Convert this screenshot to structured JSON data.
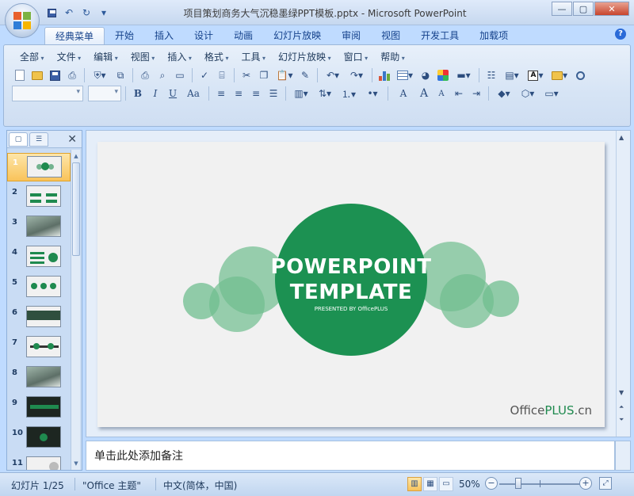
{
  "window": {
    "title": "项目策划商务大气沉稳墨绿PPT模板.pptx - Microsoft PowerPoint",
    "minimize": "—",
    "maximize": "▢",
    "close": "✕"
  },
  "qat": {
    "save_icon": "save-icon",
    "undo_icon": "undo-icon",
    "redo_icon": "redo-icon",
    "customize": "▾"
  },
  "tabs": [
    {
      "label": "经典菜单",
      "active": true
    },
    {
      "label": "开始"
    },
    {
      "label": "插入"
    },
    {
      "label": "设计"
    },
    {
      "label": "动画"
    },
    {
      "label": "幻灯片放映"
    },
    {
      "label": "审阅"
    },
    {
      "label": "视图"
    },
    {
      "label": "开发工具"
    },
    {
      "label": "加载项"
    }
  ],
  "help": "?",
  "menus": [
    "全部",
    "文件",
    "编辑",
    "视图",
    "插入",
    "格式",
    "工具",
    "幻灯片放映",
    "窗口",
    "帮助"
  ],
  "format": {
    "bold": "B",
    "italic": "I",
    "underline": "U",
    "case": "Aa",
    "grow_font": "A",
    "shrink_font": "A",
    "text_box": "A"
  },
  "left_panel": {
    "tab_slides_icon": "slides-tab-icon",
    "tab_outline_icon": "outline-tab-icon",
    "close": "✕",
    "slides": [
      {
        "num": "1",
        "selected": true
      },
      {
        "num": "2"
      },
      {
        "num": "3"
      },
      {
        "num": "4"
      },
      {
        "num": "5"
      },
      {
        "num": "6"
      },
      {
        "num": "7"
      },
      {
        "num": "8"
      },
      {
        "num": "9"
      },
      {
        "num": "10"
      },
      {
        "num": "11"
      }
    ]
  },
  "slide": {
    "title_line1": "POWERPOINT",
    "title_line2": "TEMPLATE",
    "subtitle": "PRESENTED BY OfficePLUS",
    "brand_office": "Office",
    "brand_plus": "PLUS",
    "brand_cn": ".cn",
    "accent": "#1c9152",
    "accent_light": "#6fbd8f"
  },
  "notes": {
    "placeholder": "单击此处添加备注"
  },
  "status": {
    "slide_info": "幻灯片 1/25",
    "theme": "\"Office 主题\"",
    "language": "中文(简体，中国)",
    "zoom": "50%",
    "zoom_out": "−",
    "zoom_in": "+"
  }
}
